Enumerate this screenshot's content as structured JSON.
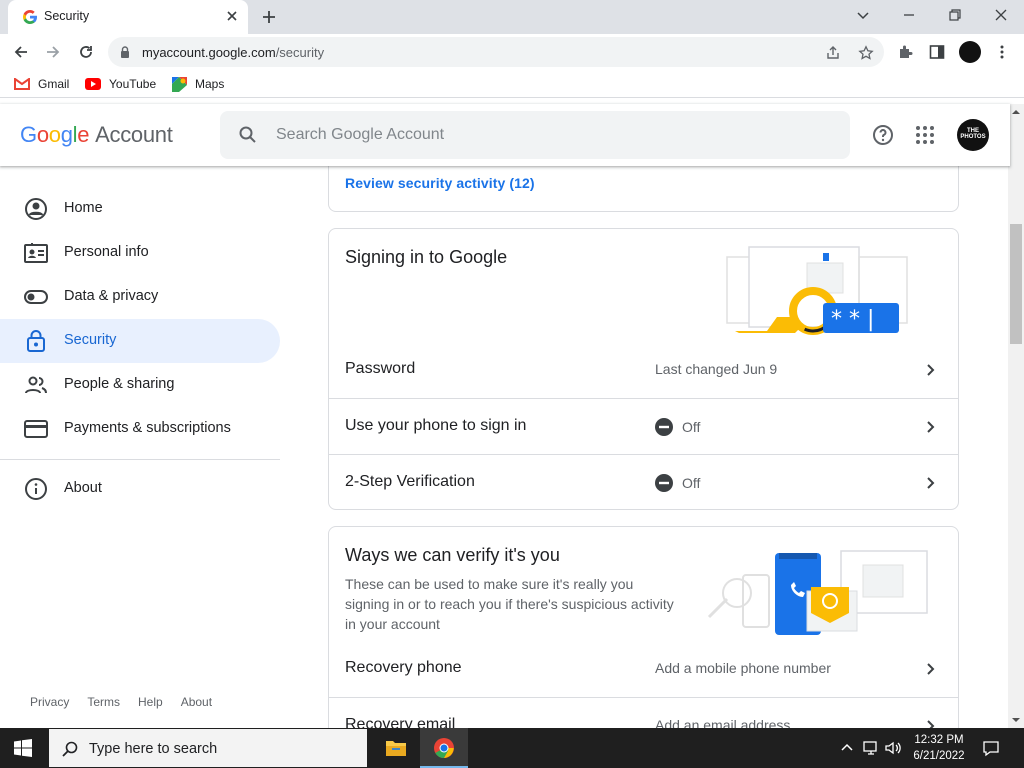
{
  "browser": {
    "tab_title": "Security",
    "url_domain": "myaccount.google.com",
    "url_path": "/security",
    "bookmarks": [
      {
        "label": "Gmail",
        "icon": "gmail-icon"
      },
      {
        "label": "YouTube",
        "icon": "youtube-icon"
      },
      {
        "label": "Maps",
        "icon": "maps-icon"
      }
    ]
  },
  "header": {
    "logo_google": "Google",
    "logo_account": "Account",
    "search_placeholder": "Search Google Account",
    "avatar_text": "THE PHOTOS"
  },
  "sidebar": {
    "items": [
      {
        "label": "Home",
        "icon": "home-icon"
      },
      {
        "label": "Personal info",
        "icon": "id-card-icon"
      },
      {
        "label": "Data & privacy",
        "icon": "toggle-icon"
      },
      {
        "label": "Security",
        "icon": "lock-icon",
        "active": true
      },
      {
        "label": "People & sharing",
        "icon": "people-icon"
      },
      {
        "label": "Payments & subscriptions",
        "icon": "card-icon"
      },
      {
        "label": "About",
        "icon": "info-icon"
      }
    ],
    "footer": [
      "Privacy",
      "Terms",
      "Help",
      "About"
    ]
  },
  "main": {
    "review_link": "Review security activity (12)",
    "signing": {
      "title": "Signing in to Google",
      "rows": [
        {
          "label": "Password",
          "value": "Last changed Jun 9",
          "off": false
        },
        {
          "label": "Use your phone to sign in",
          "value": "Off",
          "off": true
        },
        {
          "label": "2-Step Verification",
          "value": "Off",
          "off": true
        }
      ]
    },
    "verify": {
      "title": "Ways we can verify it's you",
      "description": "These can be used to make sure it's really you signing in or to reach you if there's suspicious activity in your account",
      "rows": [
        {
          "label": "Recovery phone",
          "value": "Add a mobile phone number"
        },
        {
          "label": "Recovery email",
          "value": "Add an email address"
        }
      ]
    }
  },
  "taskbar": {
    "search_text": "Type here to search",
    "time": "12:32 PM",
    "date": "6/21/2022"
  },
  "colors": {
    "accent": "#1a73e8",
    "active_nav_bg": "#e8f0fe",
    "taskbar": "#1f1f1f"
  }
}
